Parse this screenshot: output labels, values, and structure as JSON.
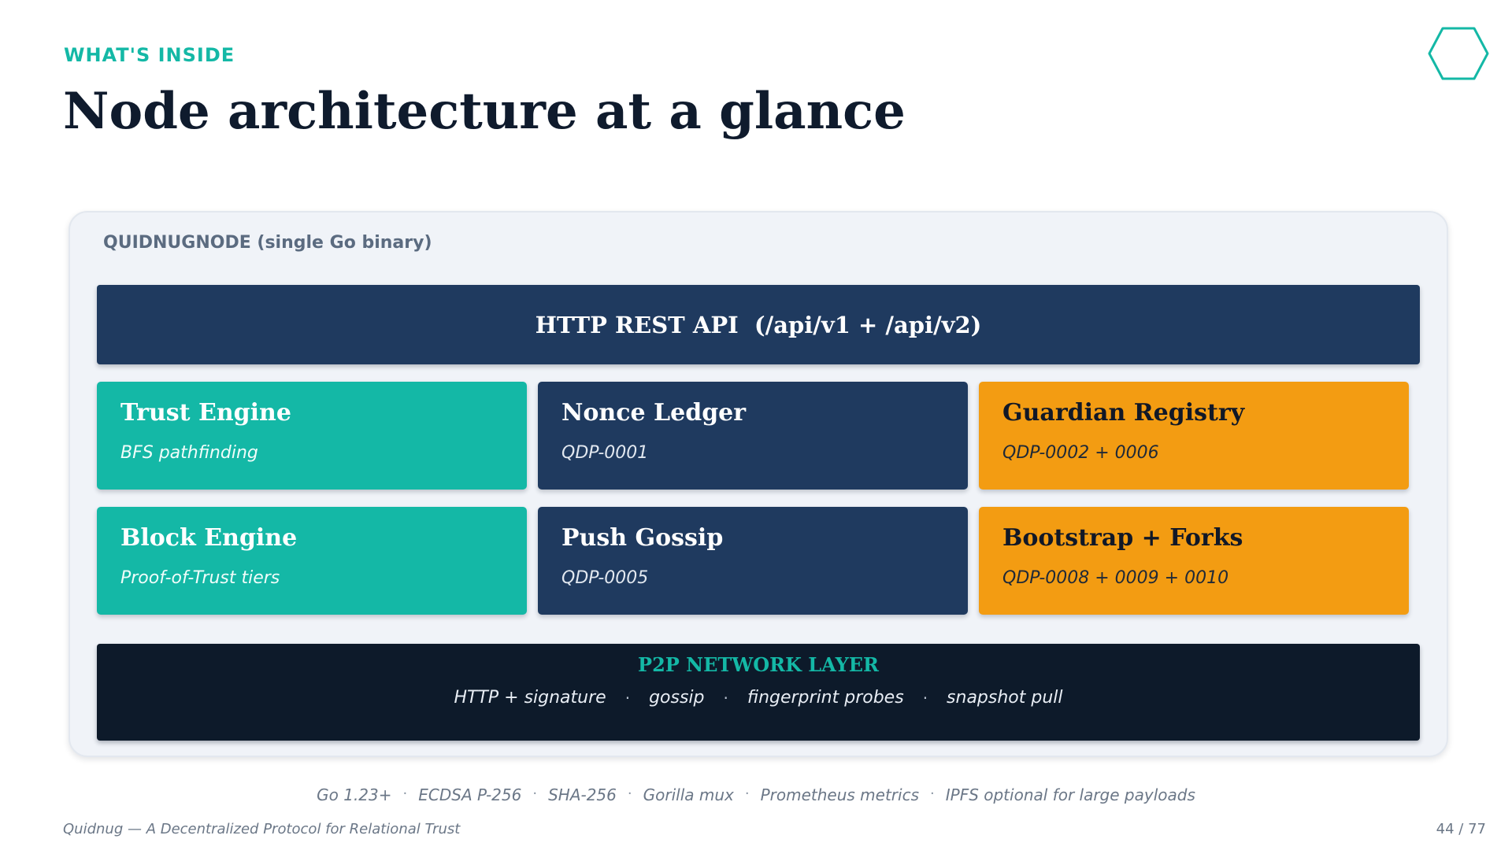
{
  "header": {
    "eyebrow": "WHAT'S INSIDE",
    "title": "Node architecture at a glance",
    "logo_icon": "hexagon-outline-icon"
  },
  "diagram": {
    "container_label": "QUIDNUGNODE (single Go binary)",
    "api_bar": "HTTP REST API  (/api/v1 + /api/v2)",
    "components": [
      {
        "title": "Trust Engine",
        "subtitle": "BFS pathfinding",
        "color": "#14b8a6"
      },
      {
        "title": "Nonce Ledger",
        "subtitle": "QDP-0001",
        "color": "#1f3a5f"
      },
      {
        "title": "Guardian Registry",
        "subtitle": "QDP-0002 + 0006",
        "color": "#f39c12"
      },
      {
        "title": "Block Engine",
        "subtitle": "Proof-of-Trust tiers",
        "color": "#14b8a6"
      },
      {
        "title": "Push Gossip",
        "subtitle": "QDP-0005",
        "color": "#1f3a5f"
      },
      {
        "title": "Bootstrap + Forks",
        "subtitle": "QDP-0008 + 0009 + 0010",
        "color": "#f39c12"
      }
    ],
    "p2p": {
      "title": "P2P NETWORK LAYER",
      "items": [
        "HTTP + signature",
        "gossip",
        "fingerprint probes",
        "snapshot pull"
      ],
      "separator": "·"
    }
  },
  "tech_stack": {
    "items": [
      "Go 1.23+",
      "ECDSA P-256",
      "SHA-256",
      "Gorilla mux",
      "Prometheus metrics",
      "IPFS optional for large payloads"
    ],
    "separator": "·"
  },
  "footer": {
    "left": "Quidnug — A Decentralized Protocol for Relational Trust",
    "page": "44 / 77"
  },
  "colors": {
    "accent_teal": "#14b8a6",
    "navy": "#1f3a5f",
    "amber": "#f39c12",
    "dark": "#0d1a2a"
  }
}
